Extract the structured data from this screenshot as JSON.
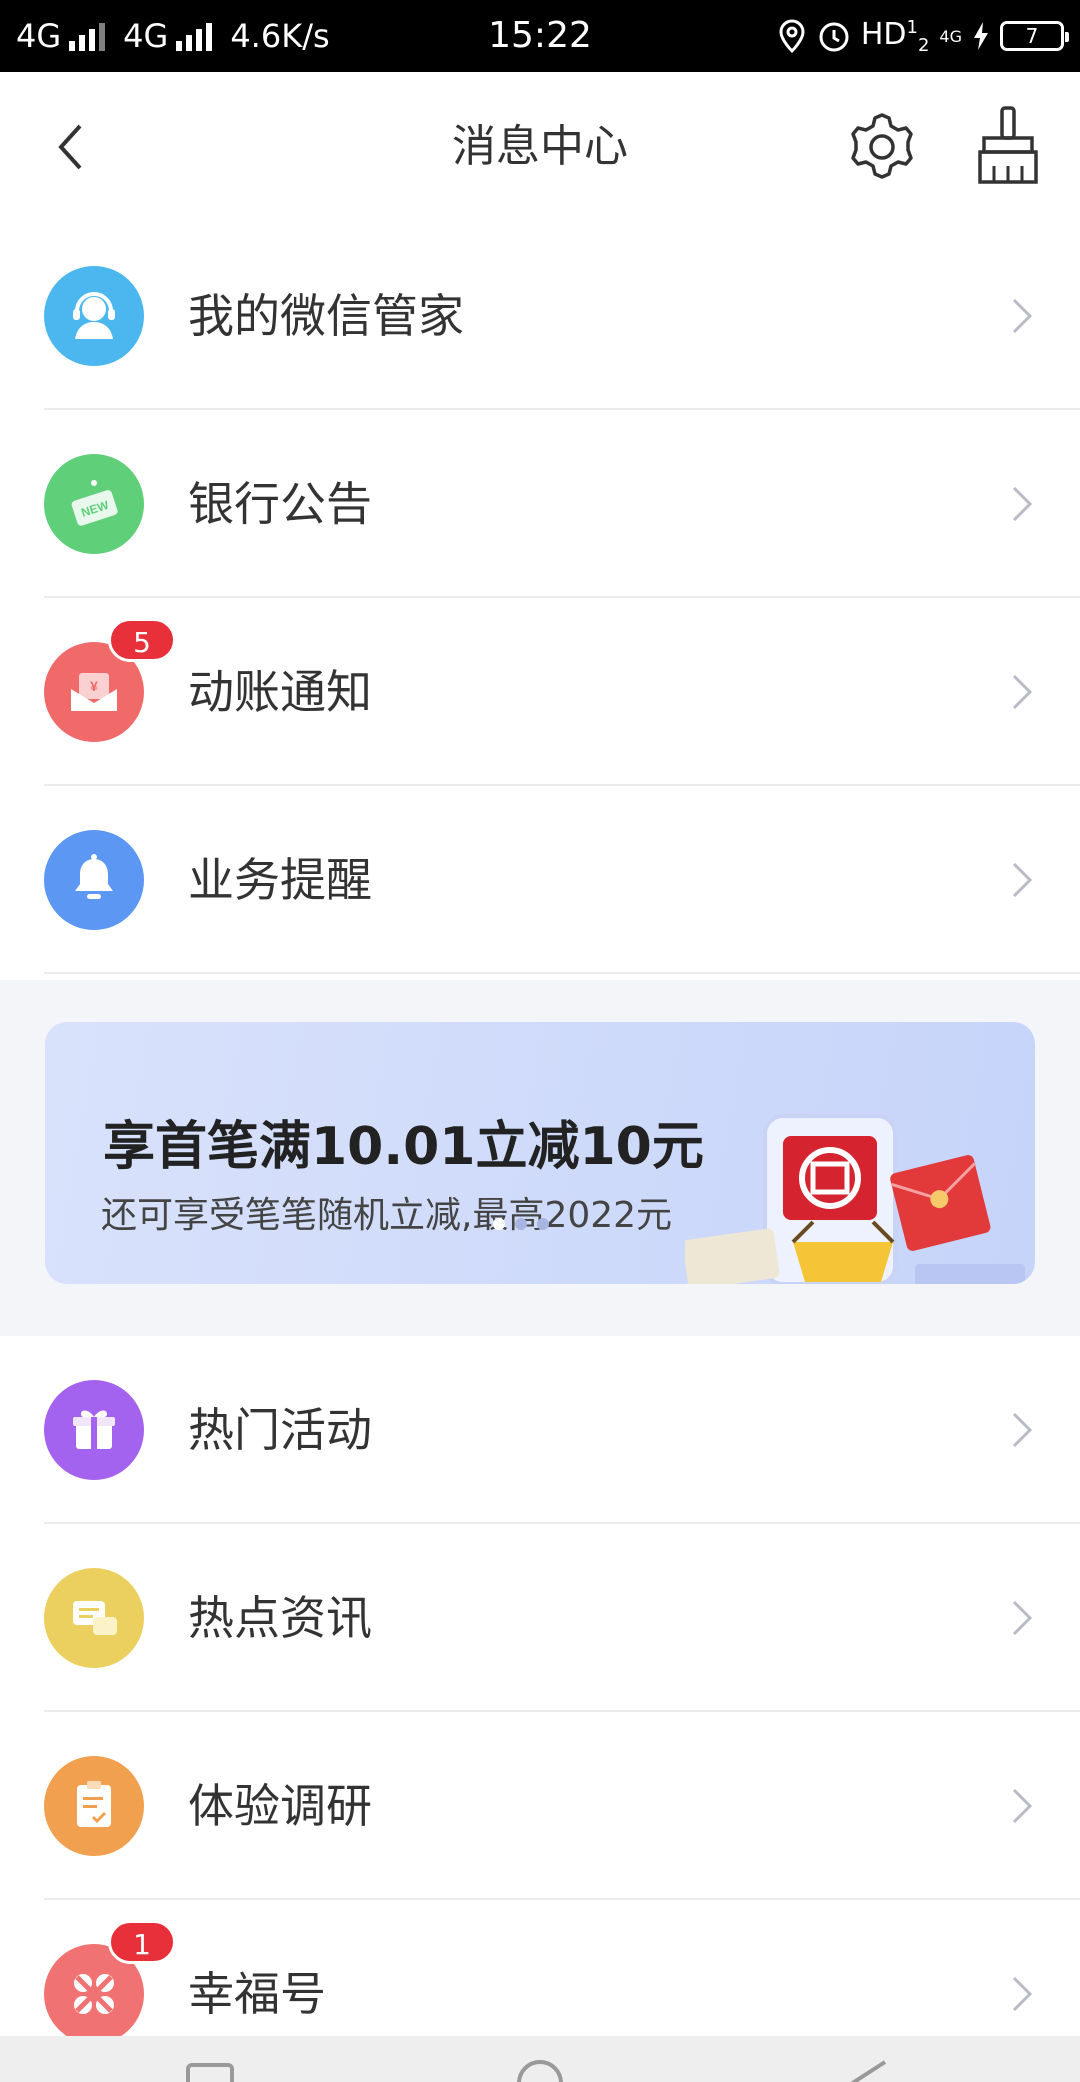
{
  "status_bar": {
    "network1": "4G",
    "network2": "4G",
    "speed": "4.6K/s",
    "time": "15:22",
    "hd": "HD",
    "hd_sup": "1",
    "hd_sub": "2",
    "net_small": "4G",
    "battery": "7"
  },
  "nav": {
    "title": "消息中心"
  },
  "items_top": [
    {
      "label": "我的微信管家",
      "icon": "customer-service-icon",
      "color": "#4cb7ee"
    },
    {
      "label": "银行公告",
      "icon": "new-sign-icon",
      "color": "#5fcf7a"
    },
    {
      "label": "动账通知",
      "icon": "money-envelope-icon",
      "color": "#f06a6a",
      "badge": "5"
    },
    {
      "label": "业务提醒",
      "icon": "bell-icon",
      "color": "#5b97f3"
    }
  ],
  "banner": {
    "title": "享首笔满10.01立减10元",
    "subtitle": "还可享受笔笔随机立减,最高2022元"
  },
  "items_bottom": [
    {
      "label": "热门活动",
      "icon": "gift-icon",
      "color": "#a463ee"
    },
    {
      "label": "热点资讯",
      "icon": "chat-bubbles-icon",
      "color": "#ecd05f"
    },
    {
      "label": "体验调研",
      "icon": "clipboard-check-icon",
      "color": "#f0a04e"
    },
    {
      "label": "幸福号",
      "icon": "four-petal-icon",
      "color": "#f07272",
      "badge": "1"
    }
  ],
  "colors": {
    "badge": "#e8303a",
    "banner_bg": "#d2ddfa",
    "divider": "#ececec"
  }
}
